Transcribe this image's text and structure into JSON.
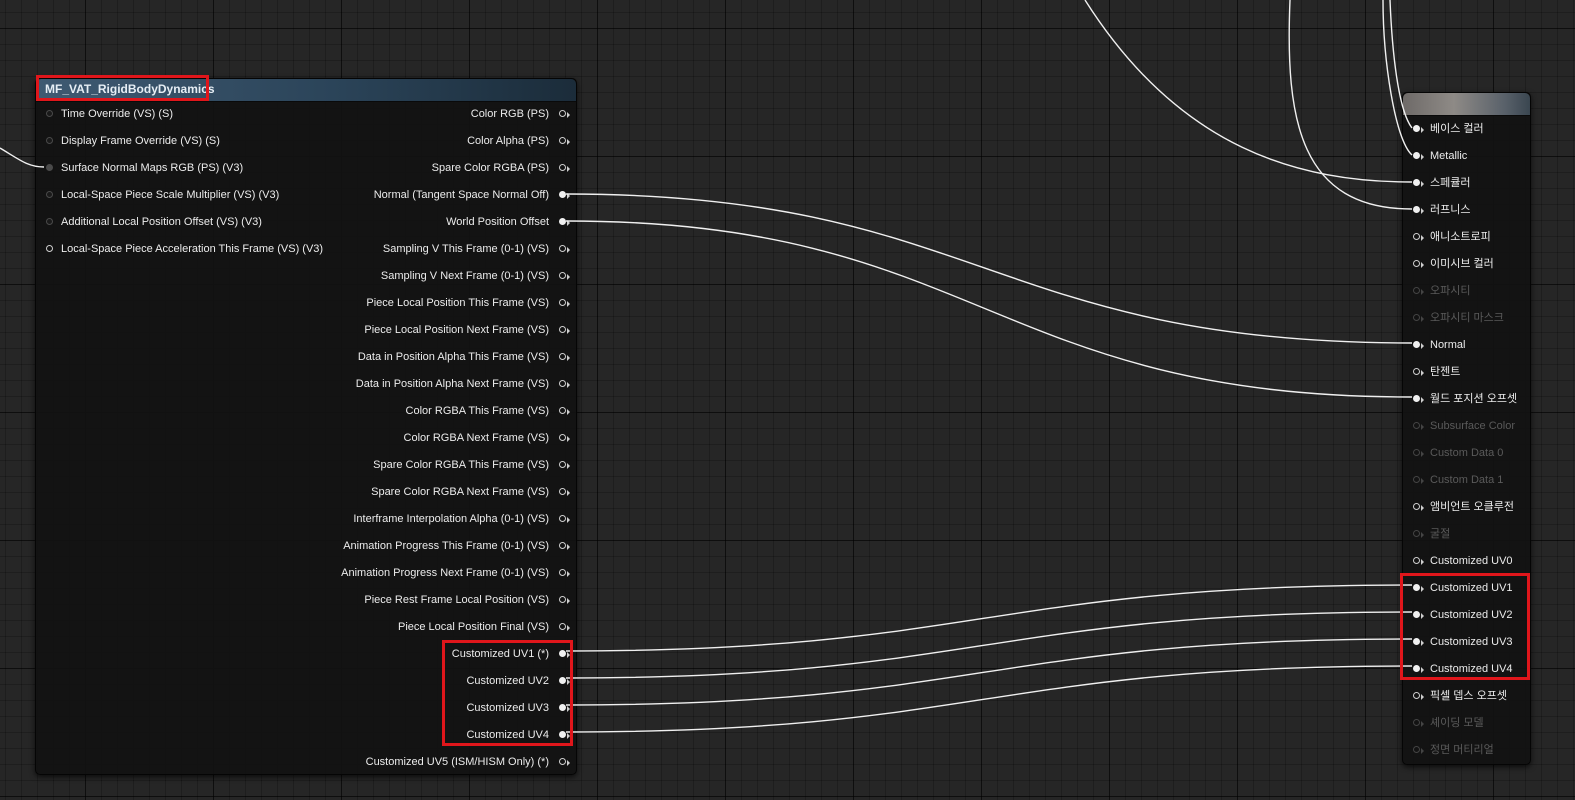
{
  "function_node": {
    "title": "MF_VAT_RigidBodyDynamics",
    "inputs": [
      {
        "label": "Time Override (VS) (S)",
        "state": "gray"
      },
      {
        "label": "Display Frame Override (VS) (S)",
        "state": "gray"
      },
      {
        "label": "Surface Normal Maps RGB (PS) (V3)",
        "state": "gray-connected"
      },
      {
        "label": "Local-Space Piece Scale Multiplier (VS) (V3)",
        "state": "gray"
      },
      {
        "label": "Additional Local Position Offset (VS) (V3)",
        "state": "gray"
      },
      {
        "label": "Local-Space Piece Acceleration This Frame (VS) (V3)",
        "state": "open"
      }
    ],
    "outputs": [
      {
        "label": "Color RGB (PS)",
        "state": "open"
      },
      {
        "label": "Color Alpha (PS)",
        "state": "open"
      },
      {
        "label": "Spare Color RGBA (PS)",
        "state": "open"
      },
      {
        "label": "Normal (Tangent Space Normal Off)",
        "state": "connected"
      },
      {
        "label": "World Position Offset",
        "state": "connected"
      },
      {
        "label": "Sampling V This Frame (0-1) (VS)",
        "state": "open"
      },
      {
        "label": "Sampling V Next Frame (0-1) (VS)",
        "state": "open"
      },
      {
        "label": "Piece Local Position This Frame (VS)",
        "state": "open"
      },
      {
        "label": "Piece Local Position Next Frame (VS)",
        "state": "open"
      },
      {
        "label": "Data in Position Alpha This Frame (VS)",
        "state": "open"
      },
      {
        "label": "Data in Position Alpha Next Frame (VS)",
        "state": "open"
      },
      {
        "label": "Color RGBA This Frame (VS)",
        "state": "open"
      },
      {
        "label": "Color RGBA Next Frame (VS)",
        "state": "open"
      },
      {
        "label": "Spare Color RGBA This Frame (VS)",
        "state": "open"
      },
      {
        "label": "Spare Color RGBA Next Frame (VS)",
        "state": "open"
      },
      {
        "label": "Interframe Interpolation Alpha (0-1) (VS)",
        "state": "open"
      },
      {
        "label": "Animation Progress This Frame (0-1) (VS)",
        "state": "open"
      },
      {
        "label": "Animation Progress Next Frame (0-1) (VS)",
        "state": "open"
      },
      {
        "label": "Piece Rest Frame Local Position (VS)",
        "state": "open"
      },
      {
        "label": "Piece Local Position Final (VS)",
        "state": "open"
      },
      {
        "label": "Customized UV1 (*)",
        "state": "connected"
      },
      {
        "label": "Customized UV2",
        "state": "connected"
      },
      {
        "label": "Customized UV3",
        "state": "connected"
      },
      {
        "label": "Customized UV4",
        "state": "connected"
      },
      {
        "label": "Customized UV5 (ISM/HISM Only) (*)",
        "state": "open"
      }
    ]
  },
  "result_node": {
    "title": "",
    "inputs": [
      {
        "label": "베이스 컬러",
        "state": "connected"
      },
      {
        "label": "Metallic",
        "state": "connected"
      },
      {
        "label": "스페큘러",
        "state": "connected"
      },
      {
        "label": "러프니스",
        "state": "connected"
      },
      {
        "label": "애니소트로피",
        "state": "open"
      },
      {
        "label": "이미시브 컬러",
        "state": "open"
      },
      {
        "label": "오파시티",
        "state": "dim"
      },
      {
        "label": "오파시티 마스크",
        "state": "dim"
      },
      {
        "label": "Normal",
        "state": "connected"
      },
      {
        "label": "탄젠트",
        "state": "open"
      },
      {
        "label": "월드 포지션 오프셋",
        "state": "connected"
      },
      {
        "label": "Subsurface Color",
        "state": "dim"
      },
      {
        "label": "Custom Data 0",
        "state": "dim"
      },
      {
        "label": "Custom Data 1",
        "state": "dim"
      },
      {
        "label": "앰비언트 오클루전",
        "state": "open"
      },
      {
        "label": "굴절",
        "state": "dim"
      },
      {
        "label": "Customized UV0",
        "state": "open"
      },
      {
        "label": "Customized UV1",
        "state": "connected"
      },
      {
        "label": "Customized UV2",
        "state": "connected"
      },
      {
        "label": "Customized UV3",
        "state": "connected"
      },
      {
        "label": "Customized UV4",
        "state": "connected"
      },
      {
        "label": "픽셀 뎁스 오프셋",
        "state": "open"
      },
      {
        "label": "셰이딩 모델",
        "state": "dim"
      },
      {
        "label": "정면 머티리얼",
        "state": "dim"
      }
    ]
  },
  "colors": {
    "background": "#262626",
    "wire": "#f0f0f0",
    "highlight": "#e0161b",
    "header": "#3f5a72"
  }
}
